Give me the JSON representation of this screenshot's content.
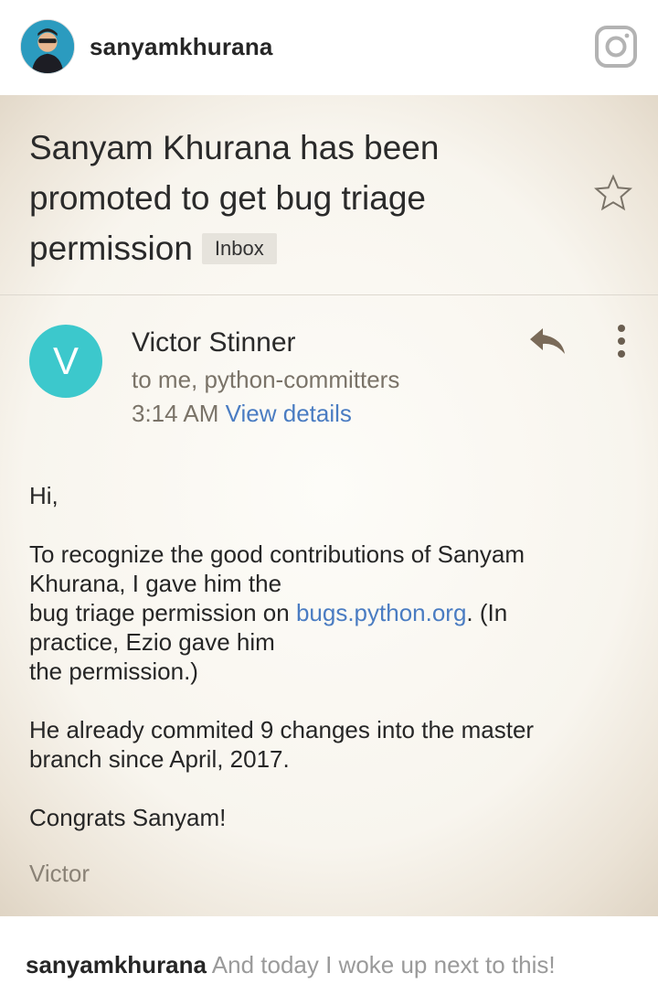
{
  "header": {
    "username": "sanyamkhurana",
    "avatar_icon": "profile-photo",
    "app_icon": "instagram-camera-icon"
  },
  "email": {
    "subject": "Sanyam Khurana has been promoted to get bug triage permission",
    "label": "Inbox",
    "sender": {
      "initial": "V",
      "name": "Victor Stinner",
      "recipients": "to me, python-committers",
      "time": "3:14 AM",
      "view_details": "View details",
      "avatar_color": "#3cc8cc"
    },
    "body": {
      "greeting": "Hi,",
      "p1_a": "To recognize the good contributions of Sanyam Khurana, I gave him the",
      "p1_b": "bug triage permission on ",
      "p1_link": "bugs.python.org",
      "p1_c": ". (In practice, Ezio gave him",
      "p1_d": "the permission.)",
      "p2": "He already commited 9 changes into the master branch since April, 2017.",
      "p3": "Congrats Sanyam!",
      "signature": "Victor"
    },
    "link_color": "#4a7cc2"
  },
  "caption": {
    "username": "sanyamkhurana",
    "text": "And today I woke up next to this!"
  }
}
